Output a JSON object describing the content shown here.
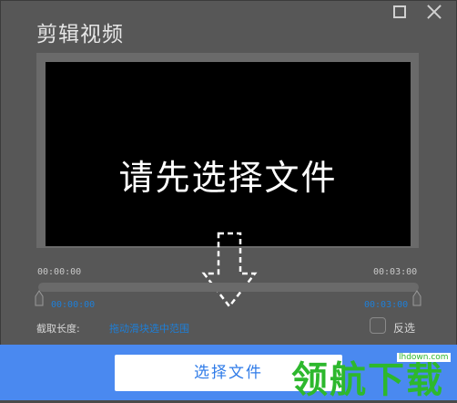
{
  "window": {
    "title": "剪辑视频"
  },
  "player": {
    "placeholder": "请先选择文件"
  },
  "timeline": {
    "start_time": "00:00:00",
    "end_time": "00:03:00",
    "selection_start": "00:00:00",
    "selection_end": "00:03:00"
  },
  "range": {
    "label": "截取长度:",
    "hint": "拖动滑块选中范围",
    "invert_label": "反选",
    "invert_checked": false
  },
  "footer": {
    "select_file_label": "选择文件"
  },
  "watermark": {
    "text": "领航下载",
    "url": "lhdown.com"
  },
  "colors": {
    "accent": "#4a89f0",
    "link": "#1e7fd8",
    "watermark": "#2db82d"
  }
}
